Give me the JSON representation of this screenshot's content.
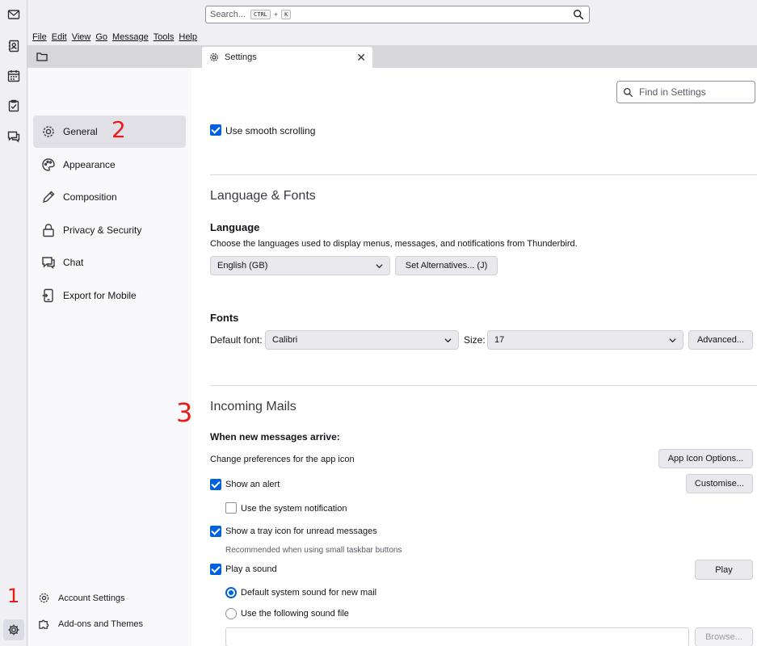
{
  "search": {
    "placeholder": "Search...",
    "key1": "CTRL",
    "plus": "+",
    "key2": "K"
  },
  "menubar": [
    "File",
    "Edit",
    "View",
    "Go",
    "Message",
    "Tools",
    "Help"
  ],
  "tab": {
    "label": "Settings"
  },
  "find": {
    "placeholder": "Find in Settings"
  },
  "sidebar": {
    "categories": [
      "General",
      "Appearance",
      "Composition",
      "Privacy & Security",
      "Chat",
      "Export for Mobile"
    ],
    "account_settings": "Account Settings",
    "addons": "Add-ons and Themes"
  },
  "general": {
    "smooth_scrolling": "Use smooth scrolling"
  },
  "language_fonts": {
    "title": "Language & Fonts",
    "language_heading": "Language",
    "language_desc": "Choose the languages used to display menus, messages, and notifications from Thunderbird.",
    "language_value": "English (GB)",
    "set_alternatives": "Set Alternatives... (J)",
    "fonts_heading": "Fonts",
    "default_font_label": "Default font:",
    "default_font_value": "Calibri",
    "size_label": "Size:",
    "size_value": "17",
    "advanced_button": "Advanced..."
  },
  "incoming": {
    "title": "Incoming Mails",
    "when_heading": "When new messages arrive:",
    "app_icon_desc": "Change preferences for the app icon",
    "app_icon_button": "App Icon Options...",
    "show_alert": "Show an alert",
    "customise_button": "Customise...",
    "system_notification": "Use the system notification",
    "tray_icon": "Show a tray icon for unread messages",
    "tray_hint": "Recommended when using small taskbar buttons",
    "play_sound": "Play a sound",
    "play_button": "Play",
    "default_sound": "Default system sound for new mail",
    "following_sound": "Use the following sound file",
    "browse_button": "Browse..."
  },
  "annotations": {
    "one": "1",
    "two": "2",
    "three": "3"
  },
  "colors": {
    "accent": "#0061e0",
    "annotation": "#e81b1b"
  }
}
